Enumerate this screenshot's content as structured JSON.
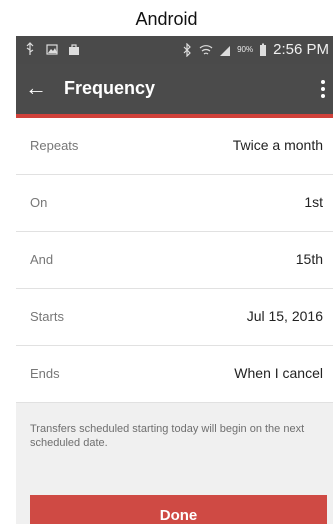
{
  "caption": "Android",
  "status_bar": {
    "battery_percent": "90%",
    "time": "2:56 PM",
    "icons": [
      "usb-icon",
      "image-icon",
      "shopping-bag-icon",
      "bluetooth-icon",
      "wifi-icon",
      "signal-icon",
      "battery-icon"
    ]
  },
  "app_bar": {
    "back_glyph": "←",
    "title": "Frequency"
  },
  "rows": [
    {
      "label": "Repeats",
      "value": "Twice a month"
    },
    {
      "label": "On",
      "value": "1st"
    },
    {
      "label": "And",
      "value": "15th"
    },
    {
      "label": "Starts",
      "value": "Jul 15, 2016"
    },
    {
      "label": "Ends",
      "value": "When I cancel"
    }
  ],
  "note": "Transfers scheduled starting today will begin on the next scheduled date.",
  "done_label": "Done",
  "colors": {
    "accent": "#d0413a",
    "app_bar": "#4b4b4b",
    "button": "#cf4a44"
  }
}
